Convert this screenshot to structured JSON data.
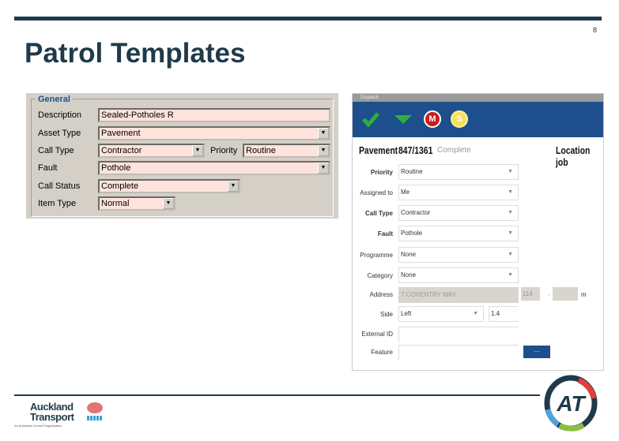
{
  "slide": {
    "title": "Patrol Templates",
    "page_number": "8"
  },
  "legacy_form": {
    "group_title": "General",
    "fields": [
      {
        "label": "Description",
        "value": "Sealed-Potholes R"
      },
      {
        "label": "Asset Type",
        "value": "Pavement"
      },
      {
        "label": "Call Type",
        "value": "Contractor"
      },
      {
        "label": "Priority",
        "value": "Routine"
      },
      {
        "label": "Fault",
        "value": "Pothole"
      },
      {
        "label": "Call Status",
        "value": "Complete"
      },
      {
        "label": "Item Type",
        "value": "Normal"
      }
    ]
  },
  "dispatch": {
    "window_title": "Dispatch",
    "toolbar": {
      "accept": "check-icon",
      "down": "triangle-down-icon",
      "m_badge": "M",
      "s_badge": "S",
      "toolbar_color": "#1d4f8c"
    },
    "header": {
      "asset": "Pavement",
      "job_number": "847/1361",
      "status": "Complete",
      "location": "Location job"
    },
    "fields": [
      {
        "label": "Priority",
        "value": "Routine"
      },
      {
        "label": "Assigned to",
        "value": "Me"
      },
      {
        "label": "Call Type",
        "value": "Contractor"
      },
      {
        "label": "Fault",
        "value": "Pothole"
      },
      {
        "label": "Programme",
        "value": "None"
      },
      {
        "label": "Category",
        "value": "None"
      }
    ],
    "address": {
      "label": "Address",
      "value": "7 COVENTRY WAY",
      "from": "114",
      "sep": "-",
      "to": "",
      "unit": "m"
    },
    "side": {
      "label": "Side",
      "value": "Left",
      "offset": "1.4"
    },
    "external_id": {
      "label": "External ID",
      "value": ""
    },
    "feature": {
      "label": "Feature",
      "value": "",
      "button": "..."
    }
  },
  "footer": {
    "logo_text_1": "Auckland",
    "logo_text_2": "Transport",
    "logo_tagline": "An Auckland Council Organisation",
    "at_logo": "AT"
  }
}
